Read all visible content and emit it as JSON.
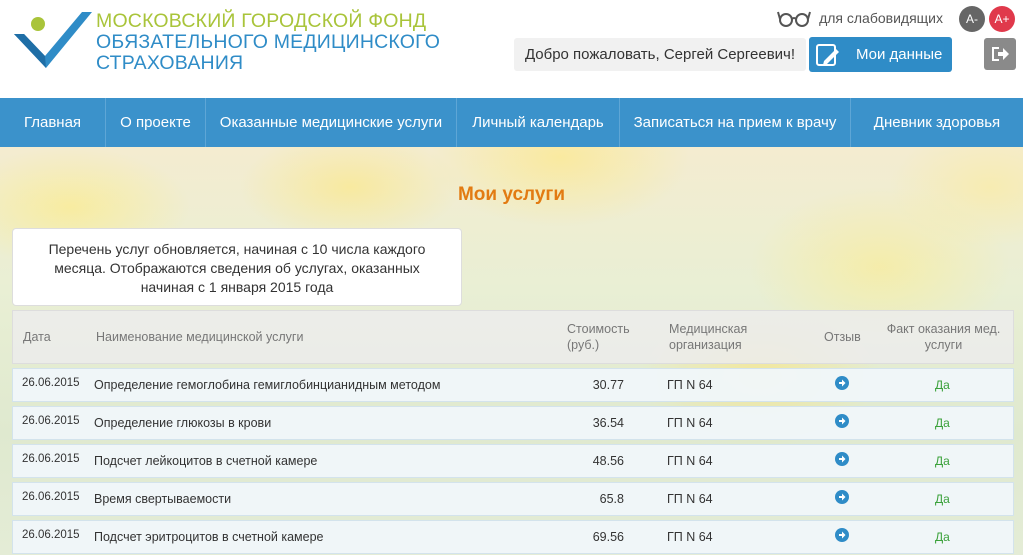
{
  "logo": {
    "line1": "Московский городской фонд",
    "line2": "обязательного медицинского",
    "line3": "страхования"
  },
  "accessibility": {
    "label": "для слабовидящих",
    "font_decrease": "A-",
    "font_increase": "A+"
  },
  "user": {
    "welcome": "Добро пожаловать, Сергей Сергеевич!",
    "my_data_label": "Мои данные"
  },
  "nav": {
    "items": [
      {
        "label": "Главная"
      },
      {
        "label": "О проекте"
      },
      {
        "label": "Оказанные медицинские услуги"
      },
      {
        "label": "Личный календарь"
      },
      {
        "label": "Записаться на прием к врачу"
      },
      {
        "label": "Дневник здоровья"
      }
    ]
  },
  "page": {
    "title": "Мои услуги",
    "notice": "Перечень услуг обновляется, начиная с 10 числа каждого месяца.  Отображаются сведения об услугах, оказанных начиная с 1 января 2015 года"
  },
  "table": {
    "headers": {
      "date": "Дата",
      "name": "Наименование медицинской услуги",
      "cost": "Стоимость (руб.)",
      "org": "Медицинская организация",
      "review": "Отзыв",
      "fact": "Факт оказания мед. услуги"
    },
    "rows": [
      {
        "date": "26.06.2015",
        "name": "Определение гемоглобина гемиглобинцианидным методом",
        "cost": "30.77",
        "org": "ГП N 64",
        "fact": "Да"
      },
      {
        "date": "26.06.2015",
        "name": "Определение глюкозы в крови",
        "cost": "36.54",
        "org": "ГП N 64",
        "fact": "Да"
      },
      {
        "date": "26.06.2015",
        "name": "Подсчет лейкоцитов в счетной камере",
        "cost": "48.56",
        "org": "ГП N 64",
        "fact": "Да"
      },
      {
        "date": "26.06.2015",
        "name": "Время свертываемости",
        "cost": "65.8",
        "org": "ГП N 64",
        "fact": "Да"
      },
      {
        "date": "26.06.2015",
        "name": "Подсчет эритроцитов в счетной камере",
        "cost": "69.56",
        "org": "ГП N 64",
        "fact": "Да"
      }
    ]
  },
  "colors": {
    "brand_blue": "#3b92cb",
    "brand_green": "#a9c43a",
    "title_orange": "#e27b12",
    "yes_green": "#3aa13a",
    "font_plus_red": "#e0394b"
  },
  "icons": {
    "logo": "checkmark-logo-icon",
    "accessibility": "glasses-icon",
    "my_data": "edit-profile-icon",
    "logout": "logout-icon",
    "review": "arrow-right-circle-icon"
  }
}
